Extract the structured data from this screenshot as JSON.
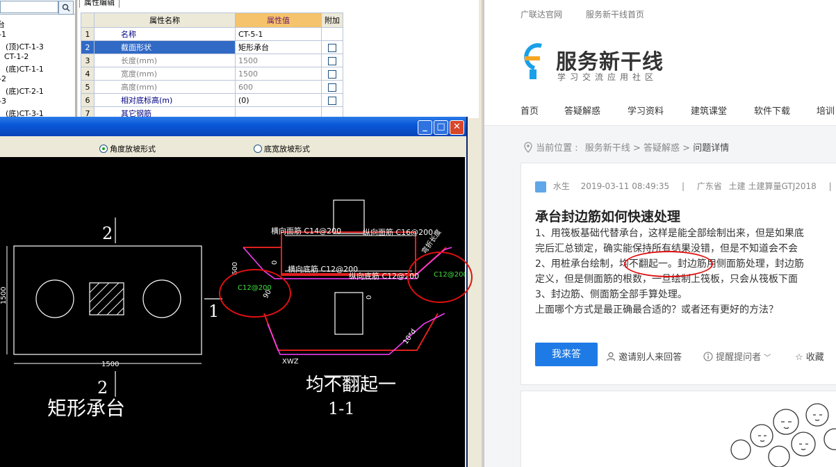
{
  "tree": {
    "search_icon": "magnifier-icon",
    "items": [
      "台",
      "-1",
      "(顶)CT-1-3",
      "CT-1-2",
      "(底)CT-1-1",
      "-2",
      "(底)CT-2-1",
      "-3",
      "(底)CT-3-1"
    ]
  },
  "property_editor": {
    "tab": "属性编辑",
    "headers": [
      "属性名称",
      "属性值",
      "附加"
    ],
    "rows": [
      {
        "no": "1",
        "name": "名称",
        "value": "CT-5-1"
      },
      {
        "no": "2",
        "name": "截面形状",
        "value": "矩形承台"
      },
      {
        "no": "3",
        "name": "长度(mm)",
        "value": "1500"
      },
      {
        "no": "4",
        "name": "宽度(mm)",
        "value": "1500"
      },
      {
        "no": "5",
        "name": "高度(mm)",
        "value": "600"
      },
      {
        "no": "6",
        "name": "相对底标高(m)",
        "value": "(0)"
      },
      {
        "no": "7",
        "name": "其它钢筋",
        "value": ""
      }
    ]
  },
  "dialog": {
    "radio_angle": "角度放坡形式",
    "radio_width": "底宽放坡形式",
    "min_icon": "minimize-icon",
    "max_icon": "maximize-icon",
    "close_icon": "close-icon"
  },
  "drawing": {
    "label_2_top": "2",
    "label_1": "1",
    "label_2_bottom": "2",
    "dim_1500_v": "1500",
    "dim_1500_h": "1500",
    "caption_left": "矩形承台",
    "caption_right": "均不翻起一",
    "section": "1-1",
    "rebar_top_h": "横向面筋 C14@200",
    "rebar_top_v": "纵向面筋 C16@200",
    "rebar_bot_h": "横向底筋 C12@200",
    "rebar_bot_v": "纵向底筋 C12@200",
    "side_left": "C12@200",
    "side_right": "C12@200",
    "dim_600": "600",
    "dim_0a": "0",
    "dim_0b": "0",
    "dim_90": "90",
    "dim_10d": "10*d",
    "dim_xwz": "XWZ",
    "bend_label": "弯折长度"
  },
  "web": {
    "top_links": [
      "广联达官网",
      "服务新干线首页"
    ],
    "logo_title": "服务新干线",
    "logo_sub": "学习交流应用社区",
    "nav": [
      "首页",
      "答疑解惑",
      "学习资料",
      "建筑课堂",
      "软件下载",
      "培训"
    ],
    "breadcrumb": {
      "label": "当前位置 :",
      "path1": "服务新干线",
      "sep1": ">",
      "path2": "答疑解惑",
      "sep2": ">",
      "current": "问题详情"
    },
    "question": {
      "author": "水生",
      "time": "2019-03-11 08:49:35",
      "sep1": "|",
      "region": "广东省",
      "tags": "土建 土建算量GTJ2018",
      "sep2": "|",
      "extra": "4",
      "title": "承台封边筋如何快速处理",
      "lines": [
        "1、用筏板基础代替承台，这样是能全部绘制出来，但是如果底",
        "完后汇总锁定，确实能保持所有结果没错，但是不知道会不会",
        "2、用桩承台绘制，均不翻起一。封边筋用侧面筋处理，封边筋",
        "定义，但是侧面筋的根数，一旦绘制上筏板，只会从筏板下面",
        "3、封边筋、侧面筋全部手算处理。",
        "上面哪个方式是最正确最合适的？或者还有更好的方法？"
      ]
    },
    "actions": {
      "answer": "我来答",
      "invite": "邀请别人来回答",
      "remind": "提醒提问者",
      "collect": "收藏"
    }
  }
}
